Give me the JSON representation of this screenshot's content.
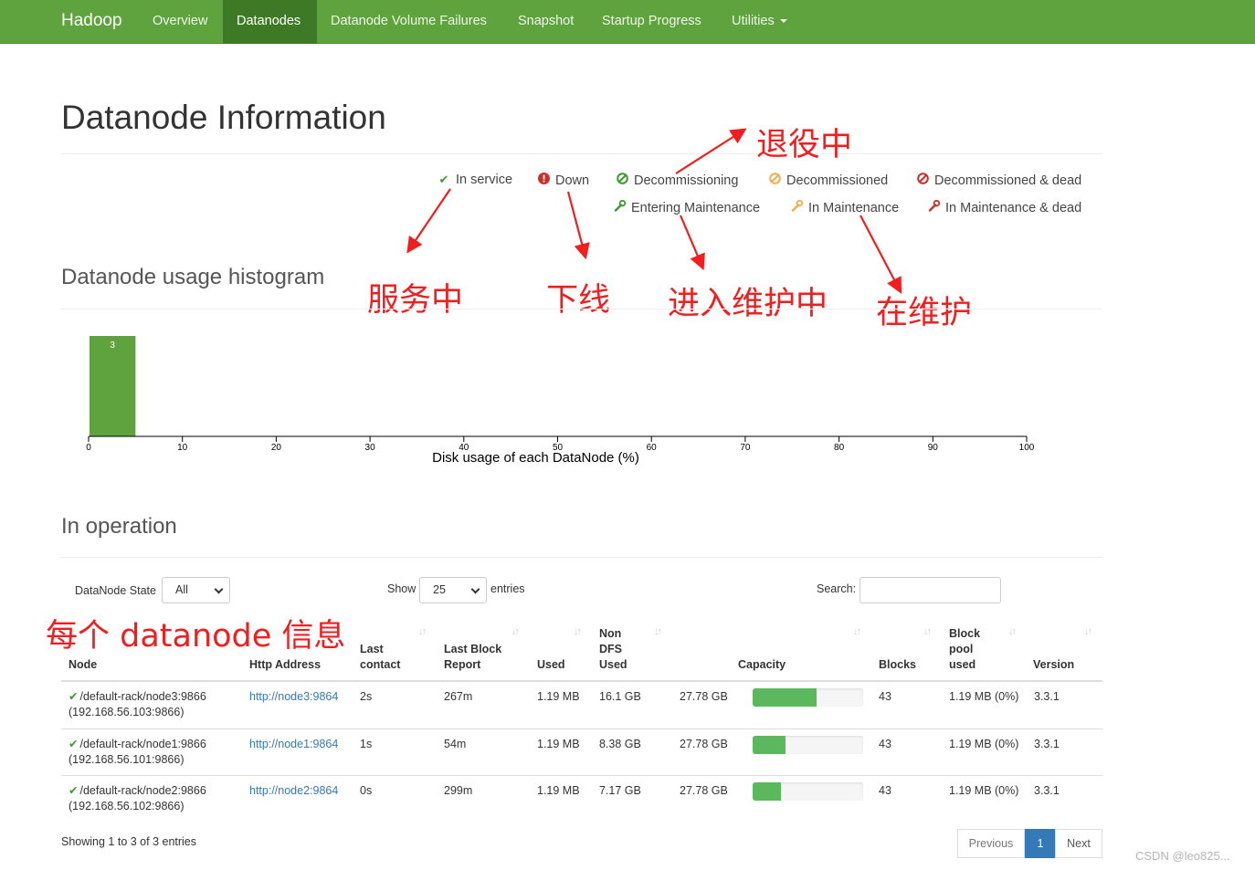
{
  "navbar": {
    "brand": "Hadoop",
    "items": [
      {
        "label": "Overview"
      },
      {
        "label": "Datanodes"
      },
      {
        "label": "Datanode Volume Failures"
      },
      {
        "label": "Snapshot"
      },
      {
        "label": "Startup Progress"
      },
      {
        "label": "Utilities"
      }
    ],
    "active": "Datanodes",
    "color": "#5fa33e"
  },
  "page_title": "Datanode Information",
  "legend": [
    {
      "label": "In service",
      "icon": "check-icon",
      "color": "#3c9a2f"
    },
    {
      "label": "Down",
      "icon": "exclamation-circle-icon",
      "color": "#c9302c"
    },
    {
      "label": "Decommissioning",
      "icon": "ban-icon",
      "color": "#3c9a2f"
    },
    {
      "label": "Decommissioned",
      "icon": "ban-icon",
      "color": "#f0ad4e"
    },
    {
      "label": "Decommissioned & dead",
      "icon": "ban-icon",
      "color": "#c9302c"
    },
    {
      "label": "Entering Maintenance",
      "icon": "wrench-icon",
      "color": "#3c9a2f"
    },
    {
      "label": "In Maintenance",
      "icon": "wrench-icon",
      "color": "#f0ad4e"
    },
    {
      "label": "In Maintenance & dead",
      "icon": "wrench-icon",
      "color": "#c9302c"
    }
  ],
  "annotations": {
    "decommissioning": "退役中",
    "in_service": "服务中",
    "down": "下线",
    "entering_maintenance": "进入维护中",
    "in_maintenance": "在维护",
    "table_note": "每个 datanode 信息",
    "color": "#f01e1e"
  },
  "histogram_title": "Datanode usage histogram",
  "chart_data": {
    "type": "bar",
    "xlabel": "Disk usage of each DataNode (%)",
    "x_ticks": [
      0,
      10,
      20,
      30,
      40,
      50,
      60,
      70,
      80,
      90,
      100
    ],
    "xlim": [
      0,
      100
    ],
    "bins": [
      {
        "from": 0,
        "to": 5,
        "count": 3
      }
    ],
    "bar_color": "#5fa33e"
  },
  "operation_title": "In operation",
  "controls": {
    "state_label": "DataNode State",
    "state_value": "All",
    "show_label": "Show",
    "show_value": "25",
    "entries_label": "entries",
    "search_label": "Search:"
  },
  "table": {
    "headers": {
      "node": "Node",
      "http": "Http Address",
      "last_contact": [
        "Last",
        "contact"
      ],
      "last_block": [
        "Last Block",
        "Report"
      ],
      "used": "Used",
      "non_dfs": [
        "Non",
        "DFS",
        "Used"
      ],
      "capacity": "Capacity",
      "blocks": "Blocks",
      "block_pool": [
        "Block",
        "pool",
        "used"
      ],
      "version": "Version"
    },
    "rows": [
      {
        "node": "/default-rack/node3:9866",
        "ip": "(192.168.56.103:9866)",
        "http": "http://node3:9864",
        "last_contact": "2s",
        "last_block": "267m",
        "used": "1.19 MB",
        "non_dfs": "16.1 GB",
        "capacity": "27.78 GB",
        "usage_pct": 58,
        "blocks": "43",
        "block_pool": "1.19 MB (0%)",
        "version": "3.3.1"
      },
      {
        "node": "/default-rack/node1:9866",
        "ip": "(192.168.56.101:9866)",
        "http": "http://node1:9864",
        "last_contact": "1s",
        "last_block": "54m",
        "used": "1.19 MB",
        "non_dfs": "8.38 GB",
        "capacity": "27.78 GB",
        "usage_pct": 30,
        "blocks": "43",
        "block_pool": "1.19 MB (0%)",
        "version": "3.3.1"
      },
      {
        "node": "/default-rack/node2:9866",
        "ip": "(192.168.56.102:9866)",
        "http": "http://node2:9864",
        "last_contact": "0s",
        "last_block": "299m",
        "used": "1.19 MB",
        "non_dfs": "7.17 GB",
        "capacity": "27.78 GB",
        "usage_pct": 26,
        "blocks": "43",
        "block_pool": "1.19 MB (0%)",
        "version": "3.3.1"
      }
    ]
  },
  "footer": {
    "info": "Showing 1 to 3 of 3 entries",
    "previous": "Previous",
    "page": "1",
    "next": "Next"
  },
  "watermark": "CSDN @leo825..."
}
